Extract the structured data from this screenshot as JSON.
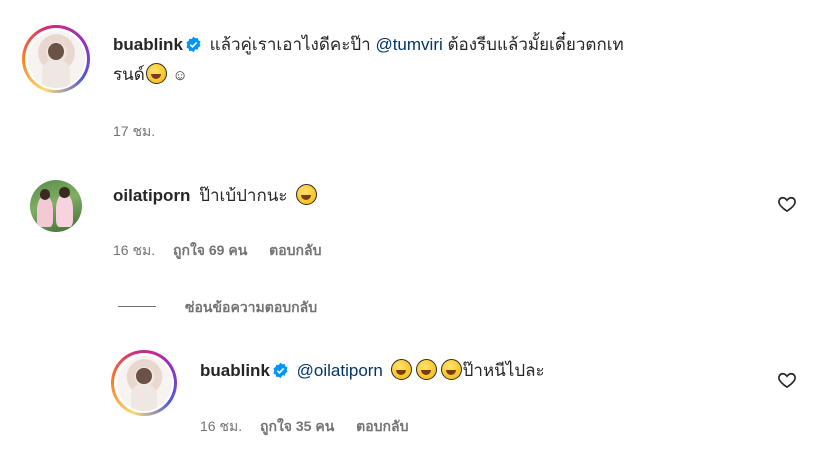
{
  "comments": [
    {
      "username": "buablink",
      "verified": true,
      "text_before": "แล้วคู่เราเอาไงดีคะป๊า",
      "mention": "@tumviri",
      "text_after_line1": "ต้องรีบแล้วมั้ยเดี๋ยวตกเท",
      "text_line2": "รนด์",
      "emoji": [
        "squinting-face-emoji",
        "smiling-face-emoji"
      ],
      "time": "17 ชม."
    },
    {
      "username": "oilatiporn",
      "text": "ป๊าเบ้ปากนะ",
      "emoji": [
        "squinting-face-emoji"
      ],
      "time": "16 ชม.",
      "likes": "ถูกใจ 69 คน",
      "reply_label": "ตอบกลับ"
    }
  ],
  "hide_replies_label": "ซ่อนข้อความตอบกลับ",
  "reply": {
    "username": "buablink",
    "verified": true,
    "mention": "@oilatiporn",
    "emoji": [
      "tears-of-joy-emoji",
      "tears-of-joy-emoji",
      "tears-of-joy-emoji"
    ],
    "text": "ป๊าหนีไปละ",
    "time": "16 ชม.",
    "likes": "ถูกใจ 35 คน",
    "reply_label": "ตอบกลับ"
  },
  "colors": {
    "verified": "#0095f6",
    "mention": "#00376b",
    "meta": "#737373"
  }
}
